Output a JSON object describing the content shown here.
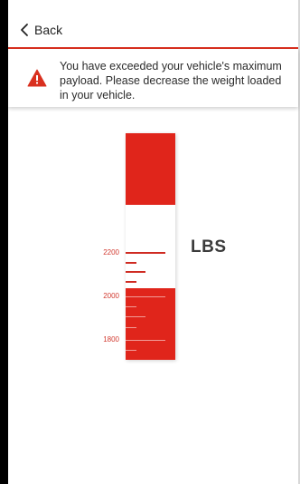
{
  "nav": {
    "back_label": "Back",
    "accent_color": "#d9301f"
  },
  "alert": {
    "icon": "warning-triangle-icon",
    "message": "You have exceeded your vehicle's maximum payload. Please decrease the weight loaded in your vehicle."
  },
  "gauge": {
    "unit": "LBS",
    "scale_labels": [
      "2200",
      "2000",
      "1800"
    ],
    "fill_color": "#e0251b"
  }
}
